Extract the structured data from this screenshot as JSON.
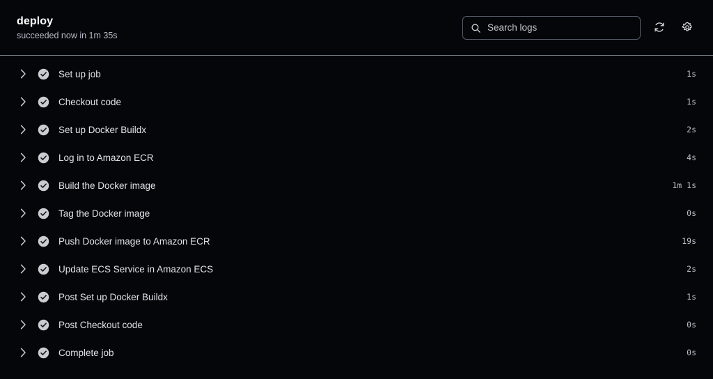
{
  "header": {
    "job_title": "deploy",
    "job_status": "succeeded now in 1m 35s",
    "search": {
      "value": "",
      "placeholder": "Search logs",
      "icon": "search-icon"
    },
    "refresh_icon": "refresh-icon",
    "settings_icon": "gear-icon"
  },
  "steps": [
    {
      "name": "Set up job",
      "duration": "1s",
      "status": "succeeded",
      "expand_icon": "chevron-right-icon",
      "status_icon": "check-circle-icon"
    },
    {
      "name": "Checkout code",
      "duration": "1s",
      "status": "succeeded",
      "expand_icon": "chevron-right-icon",
      "status_icon": "check-circle-icon"
    },
    {
      "name": "Set up Docker Buildx",
      "duration": "2s",
      "status": "succeeded",
      "expand_icon": "chevron-right-icon",
      "status_icon": "check-circle-icon"
    },
    {
      "name": "Log in to Amazon ECR",
      "duration": "4s",
      "status": "succeeded",
      "expand_icon": "chevron-right-icon",
      "status_icon": "check-circle-icon"
    },
    {
      "name": "Build the Docker image",
      "duration": "1m 1s",
      "status": "succeeded",
      "expand_icon": "chevron-right-icon",
      "status_icon": "check-circle-icon"
    },
    {
      "name": "Tag the Docker image",
      "duration": "0s",
      "status": "succeeded",
      "expand_icon": "chevron-right-icon",
      "status_icon": "check-circle-icon"
    },
    {
      "name": "Push Docker image to Amazon ECR",
      "duration": "19s",
      "status": "succeeded",
      "expand_icon": "chevron-right-icon",
      "status_icon": "check-circle-icon"
    },
    {
      "name": "Update ECS Service in Amazon ECS",
      "duration": "2s",
      "status": "succeeded",
      "expand_icon": "chevron-right-icon",
      "status_icon": "check-circle-icon"
    },
    {
      "name": "Post Set up Docker Buildx",
      "duration": "1s",
      "status": "succeeded",
      "expand_icon": "chevron-right-icon",
      "status_icon": "check-circle-icon"
    },
    {
      "name": "Post Checkout code",
      "duration": "0s",
      "status": "succeeded",
      "expand_icon": "chevron-right-icon",
      "status_icon": "check-circle-icon"
    },
    {
      "name": "Complete job",
      "duration": "0s",
      "status": "succeeded",
      "expand_icon": "chevron-right-icon",
      "status_icon": "check-circle-icon"
    }
  ],
  "colors": {
    "background": "#05060a",
    "divider": "#9aa1ad",
    "text_primary": "#ffffff",
    "text_secondary": "#b6bcc6",
    "step_text": "#dfe3e9",
    "duration_text": "#b9bfc8",
    "status_success": "#c9ccd1",
    "input_border": "#565c66"
  }
}
